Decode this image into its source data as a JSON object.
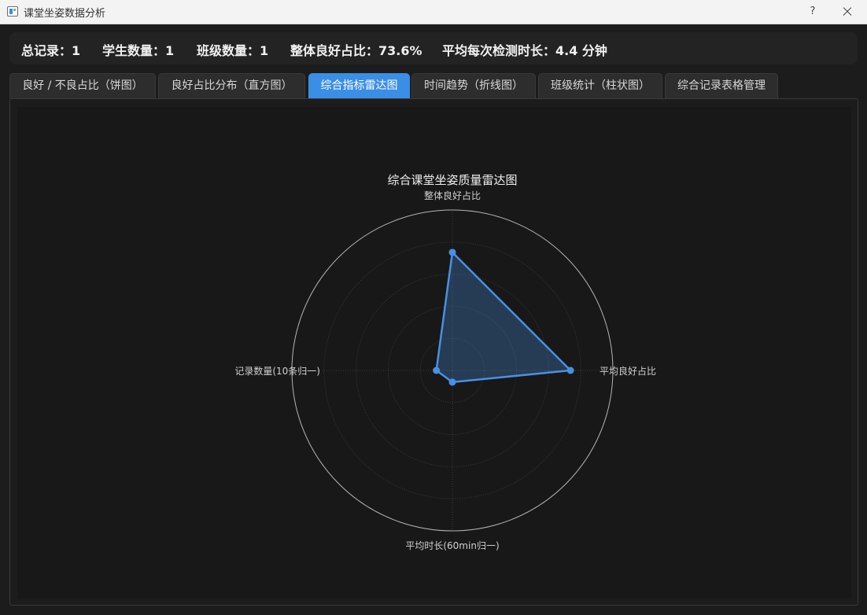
{
  "window": {
    "title": "课堂坐姿数据分析",
    "help_label": "?"
  },
  "stats": {
    "total_records": "总记录：1",
    "student_count": "学生数量：1",
    "class_count": "班级数量：1",
    "good_ratio": "整体良好占比：73.6%",
    "avg_duration": "平均每次检测时长：4.4 分钟"
  },
  "tabs": [
    {
      "label": "良好 / 不良占比（饼图）",
      "active": false
    },
    {
      "label": "良好占比分布（直方图）",
      "active": false
    },
    {
      "label": "综合指标雷达图",
      "active": true
    },
    {
      "label": "时间趋势（折线图）",
      "active": false
    },
    {
      "label": "班级统计（柱状图）",
      "active": false
    },
    {
      "label": "综合记录表格管理",
      "active": false
    }
  ],
  "chart_data": {
    "type": "radar",
    "title": "综合课堂坐姿质量雷达图",
    "axes": [
      "整体良好占比",
      "平均良好占比",
      "平均时长(60min归一)",
      "记录数量(10条归一)"
    ],
    "values": [
      0.736,
      0.736,
      0.073,
      0.1
    ],
    "rlim": [
      0,
      1
    ],
    "rings": 5,
    "colors": {
      "line": "#4a90e2",
      "fill": "#4a90e2",
      "outer_ring": "#b5b5b5",
      "grid": "#3c3c3c"
    }
  }
}
